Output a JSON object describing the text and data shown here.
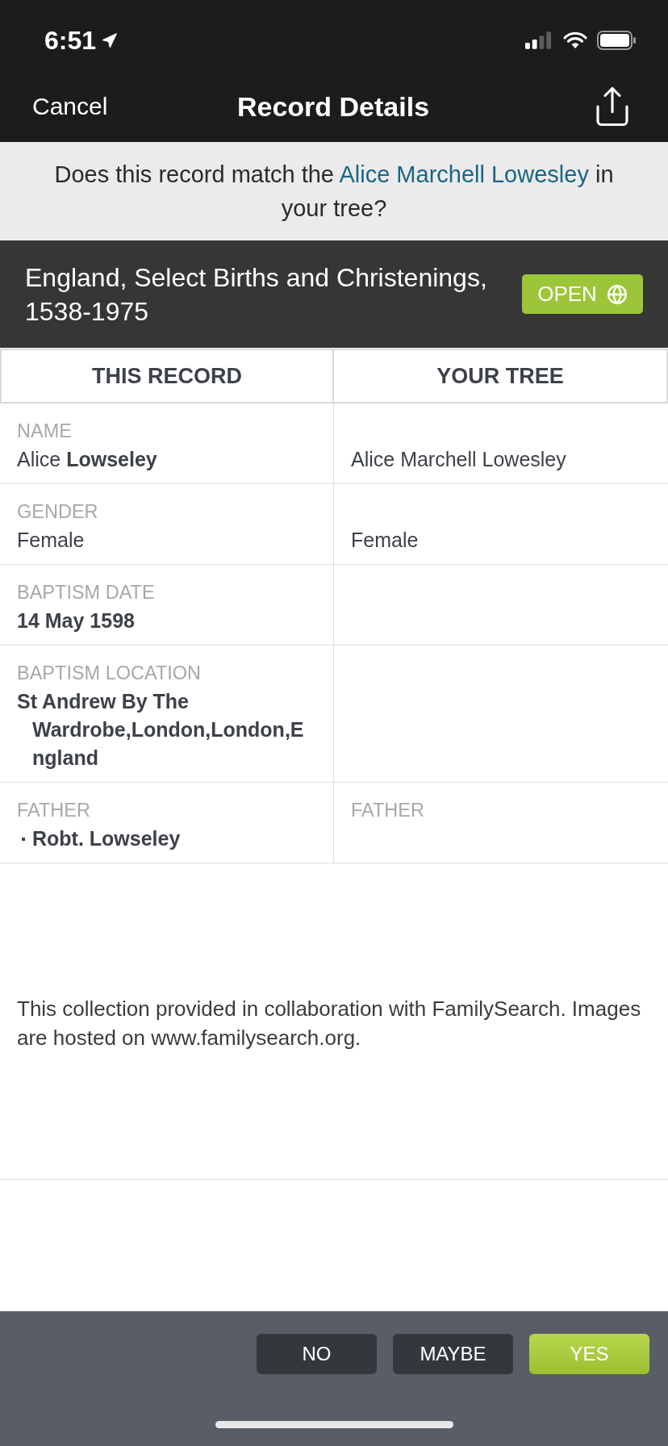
{
  "status_bar": {
    "time": "6:51"
  },
  "nav": {
    "cancel": "Cancel",
    "title": "Record Details"
  },
  "match_prompt": {
    "before": "Does this record match the ",
    "link": "Alice Marchell Lowesley",
    "after": " in your tree?"
  },
  "collection": {
    "title": "England, Select Births and Christenings, 1538-1975",
    "open_button": "OPEN"
  },
  "table": {
    "columns": [
      "THIS RECORD",
      "YOUR TREE"
    ],
    "rows": [
      {
        "record": {
          "label": "NAME",
          "value": "Alice **Lowseley**",
          "bold": false
        },
        "tree": {
          "value": "Alice Marchell Lowesley"
        }
      },
      {
        "record": {
          "label": "GENDER",
          "value": "Female",
          "bold": false
        },
        "tree": {
          "value": "Female"
        }
      },
      {
        "record": {
          "label": "BAPTISM DATE",
          "value": "14 May 1598",
          "bold": true
        },
        "tree": {}
      },
      {
        "record": {
          "label": "BAPTISM LOCATION",
          "value": "St Andrew By The Wardrobe,London,London,England",
          "bold": true
        },
        "tree": {}
      },
      {
        "record": {
          "label": "FATHER",
          "items": [
            "Robt. Lowseley"
          ],
          "bold": true
        },
        "tree": {
          "label": "FATHER"
        }
      }
    ]
  },
  "footer_note": "This collection provided in collaboration with FamilySearch. Images are hosted on www.familysearch.org.",
  "actions": [
    {
      "label": "NO",
      "kind": "secondary"
    },
    {
      "label": "MAYBE",
      "kind": "secondary"
    },
    {
      "label": "YES",
      "kind": "primary"
    }
  ]
}
